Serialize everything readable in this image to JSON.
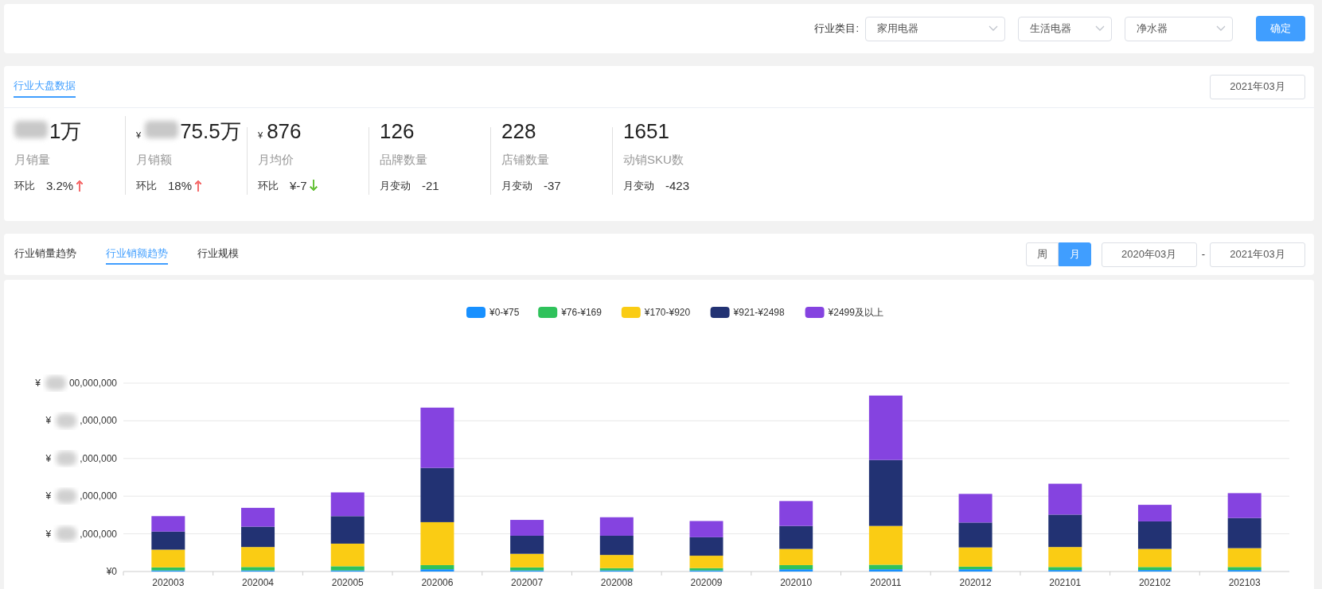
{
  "filters": {
    "label": "行业类目:",
    "selects": [
      {
        "value": "家用电器"
      },
      {
        "value": "生活电器"
      },
      {
        "value": "净水器"
      }
    ],
    "button": "确定"
  },
  "overview": {
    "tab": {
      "label": "行业大盘数据",
      "selected": true
    },
    "month": "2021年03月",
    "stats": [
      {
        "value": "1万",
        "redacted": true,
        "label": "月销量",
        "change_label": "环比",
        "change": "3.2%",
        "arrow": {
          "up": true,
          "color": "#f56c6c"
        }
      },
      {
        "currency": "¥",
        "value": "75.5万",
        "redacted": true,
        "label": "月销额",
        "change_label": "环比",
        "change": "18%",
        "arrow": {
          "up": true,
          "color": "#f56c6c"
        }
      },
      {
        "currency": "¥",
        "value": "876",
        "label": "月均价",
        "change_label": "环比",
        "change": "¥-7",
        "arrow": {
          "up": false,
          "color": "#67c23a"
        }
      },
      {
        "value": "126",
        "label": "品牌数量",
        "change_label": "月变动",
        "change": "-21"
      },
      {
        "value": "228",
        "label": "店铺数量",
        "change_label": "月变动",
        "change": "-37"
      },
      {
        "value": "1651",
        "label": "动销SKU数",
        "change_label": "月变动",
        "change": "-423"
      }
    ]
  },
  "trend_tabs": [
    {
      "label": "行业销量趋势",
      "selected": false
    },
    {
      "label": "行业销额趋势",
      "selected": true
    },
    {
      "label": "行业规模",
      "selected": false
    }
  ],
  "period": [
    {
      "label": "周",
      "selected": false
    },
    {
      "label": "月",
      "selected": true
    }
  ],
  "date_range": {
    "from": "2020年03月",
    "separator": "-",
    "to": "2021年03月"
  },
  "y_axis_labels": [
    {
      "currency": "¥",
      "text": "00,000,000",
      "redacted": true
    },
    {
      "currency": "¥",
      "text": ",000,000",
      "redacted": true
    },
    {
      "currency": "¥",
      "text": ",000,000",
      "redacted": true
    },
    {
      "currency": "¥",
      "text": ",000,000",
      "redacted": true
    },
    {
      "currency": "¥",
      "text": ",000,000",
      "redacted": true
    },
    {
      "text": "¥0"
    }
  ],
  "sales_chart": {
    "legend": [
      {
        "name": "¥0-¥75",
        "color": "#1890ff"
      },
      {
        "name": "¥76-¥169",
        "color": "#2fc25b"
      },
      {
        "name": "¥170-¥920",
        "color": "#facc14"
      },
      {
        "name": "¥921-¥2498",
        "color": "#223273"
      },
      {
        "name": "¥2499及以上",
        "color": "#8543e0"
      }
    ],
    "x_labels": [
      "202003",
      "202004",
      "202005",
      "202006",
      "202007",
      "202008",
      "202009",
      "202010",
      "202011",
      "202012",
      "202101",
      "202102",
      "202103"
    ]
  }
}
